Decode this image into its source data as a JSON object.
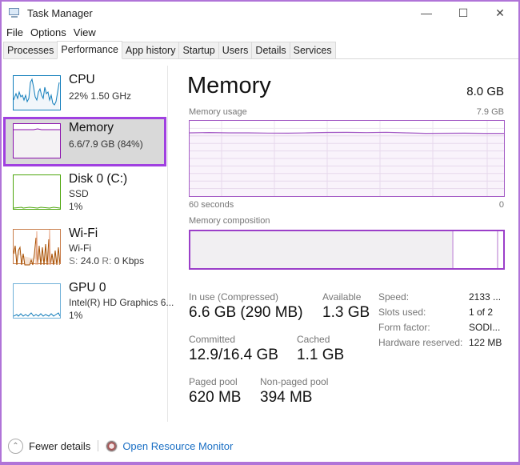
{
  "window": {
    "title": "Task Manager",
    "controls": {
      "minimize": "—",
      "maximize": "☐",
      "close": "✕"
    }
  },
  "menu": [
    "File",
    "Options",
    "View"
  ],
  "tabs": [
    {
      "label": "Processes",
      "active": false
    },
    {
      "label": "Performance",
      "active": true
    },
    {
      "label": "App history",
      "active": false
    },
    {
      "label": "Startup",
      "active": false
    },
    {
      "label": "Users",
      "active": false
    },
    {
      "label": "Details",
      "active": false
    },
    {
      "label": "Services",
      "active": false
    }
  ],
  "sidebar": {
    "items": [
      {
        "title": "CPU",
        "line1": "22%  1.50 GHz",
        "color": "#117dbb",
        "selected": false
      },
      {
        "title": "Memory",
        "line1": "6.6/7.9 GB (84%)",
        "color": "#8b12ae",
        "selected": true
      },
      {
        "title": "Disk 0 (C:)",
        "line1": "SSD",
        "line2": "1%",
        "color": "#4da60c",
        "selected": false
      },
      {
        "title": "Wi-Fi",
        "line1": "Wi-Fi",
        "line2_s_label": "S:",
        "line2_s_value": "24.0",
        "line2_r_label": "R:",
        "line2_r_value": "0 Kbps",
        "color": "#a74f01",
        "selected": false
      },
      {
        "title": "GPU 0",
        "line1": "Intel(R) HD Graphics 6...",
        "line2": "1%",
        "color": "#117dbb",
        "selected": false
      }
    ]
  },
  "main": {
    "title": "Memory",
    "total": "8.0 GB",
    "usage_label": "Memory usage",
    "usage_max": "7.9 GB",
    "time_left": "60 seconds",
    "time_right": "0",
    "composition_label": "Memory composition",
    "composition": {
      "in_use_fraction": 0.84,
      "modified_fraction": 0.005,
      "standby_fraction": 0.14,
      "free_fraction": 0.015
    },
    "usage_fraction": 0.84,
    "stats": {
      "in_use_label": "In use (Compressed)",
      "in_use_value": "6.6 GB (290 MB)",
      "available_label": "Available",
      "available_value": "1.3 GB",
      "committed_label": "Committed",
      "committed_value": "12.9/16.4 GB",
      "cached_label": "Cached",
      "cached_value": "1.1 GB",
      "paged_label": "Paged pool",
      "paged_value": "620 MB",
      "nonpaged_label": "Non-paged pool",
      "nonpaged_value": "394 MB"
    },
    "details": [
      {
        "label": "Speed:",
        "value": "2133 ..."
      },
      {
        "label": "Slots used:",
        "value": "1 of 2"
      },
      {
        "label": "Form factor:",
        "value": "SODI..."
      },
      {
        "label": "Hardware reserved:",
        "value": "122 MB"
      }
    ]
  },
  "footer": {
    "fewer_details": "Fewer details",
    "resource_monitor": "Open Resource Monitor"
  }
}
